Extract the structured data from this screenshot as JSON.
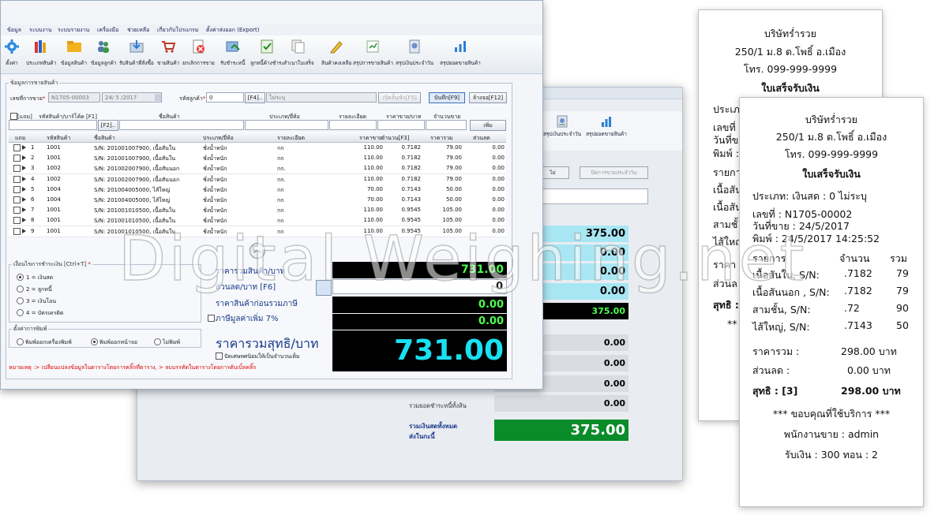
{
  "menu": [
    "ข้อมูล",
    "ระบบงาน",
    "ระบบรายงาน",
    "เครื่องมือ",
    "ช่วยเหลือ",
    "เกี่ยวกับโปรแกรม",
    "ตั้งค่าส่งออก (Export)"
  ],
  "toolbar": [
    "ตั้งค่า",
    "ประเภทสินค้า",
    "ข้อมูลสินค้า",
    "ข้อมูลลูกค้า",
    "รับสินค้าที่สั่งซื้อ",
    "ขายสินค้า",
    "ยกเลิกการขาย",
    "รับชำระหนี้",
    "ลูกหนี้ค้างชำระ",
    "สำเนาใบเสร็จ",
    "สินค้าคงเหลือ",
    "สรุปการขายสินค้า",
    "สรุปเงินประจำวัน",
    "สรุปยอดขายสินค้า"
  ],
  "sale": {
    "section_title": "ข้อมูลการขายสินค้า",
    "invoice_label": "เลขที่การขาย",
    "invoice_value": "N1705-00003",
    "date_value": "24/ 5 /2017",
    "customer_label": "รหัสลูกค้า",
    "customer_value": "0",
    "f4": "[F4]..",
    "unspecified": "ไม่ระบุ",
    "btn_cancel_bill": "เปิดลิ้นชัก[F5]",
    "btn_save": "บันทึก[F9]",
    "btn_clear": "ล้างจอ[F12]",
    "freebie": "[แถม]",
    "barcode_label": "รหัสสินค้า/บาร์โค้ด [F1]",
    "name_label": "ชื่อสินค้า",
    "type_label": "ประเภท/ยี่ห้อ",
    "detail_label": "รายละเอียด",
    "price_label": "ราคาขาย/บาท",
    "qty_label": "จำนวนขาย",
    "f2": "[F2]..",
    "add_btn": "เพิ่ม"
  },
  "grid": {
    "headers": [
      "แถม",
      "รหัสสินค้า",
      "ชื่อสินค้า",
      "ประเภท/ยี่ห้อ",
      "รายละเอียด",
      "ราคาขาย",
      "จำนวน[F3]",
      "ราคารวม",
      "ส่วนลด"
    ],
    "rows": [
      {
        "n": "1",
        "code": "1001",
        "name": "S/N: 201001007900,  เนื้อสันใน",
        "type": "ชั่งน้ำหนัก",
        "detail": "กก",
        "price": "110.00",
        "qty": "0.7182",
        "total": "79.00",
        "disc": "0.00"
      },
      {
        "n": "2",
        "code": "1001",
        "name": "S/N: 201001007900,  เนื้อสันใน",
        "type": "ชั่งน้ำหนัก",
        "detail": "กก",
        "price": "110.00",
        "qty": "0.7182",
        "total": "79.00",
        "disc": "0.00"
      },
      {
        "n": "3",
        "code": "1002",
        "name": "S/N: 201002007900,  เนื้อสันนอก",
        "type": "ชั่งน้ำหนัก",
        "detail": "กก.",
        "price": "110.00",
        "qty": "0.7182",
        "total": "79.00",
        "disc": "0.00"
      },
      {
        "n": "4",
        "code": "1002",
        "name": "S/N: 201002007900,  เนื้อสันนอก",
        "type": "ชั่งน้ำหนัก",
        "detail": "กก.",
        "price": "110.00",
        "qty": "0.7182",
        "total": "79.00",
        "disc": "0.00"
      },
      {
        "n": "5",
        "code": "1004",
        "name": "S/N: 201004005000,  ไส้ใหญ่",
        "type": "ชั่งน้ำหนัก",
        "detail": "กก",
        "price": "70.00",
        "qty": "0.7143",
        "total": "50.00",
        "disc": "0.00"
      },
      {
        "n": "6",
        "code": "1004",
        "name": "S/N: 201004005000,  ไส้ใหญ่",
        "type": "ชั่งน้ำหนัก",
        "detail": "กก",
        "price": "70.00",
        "qty": "0.7143",
        "total": "50.00",
        "disc": "0.00"
      },
      {
        "n": "7",
        "code": "1001",
        "name": "S/N: 201001010500,  เนื้อสันใน",
        "type": "ชั่งน้ำหนัก",
        "detail": "กก",
        "price": "110.00",
        "qty": "0.9545",
        "total": "105.00",
        "disc": "0.00"
      },
      {
        "n": "8",
        "code": "1001",
        "name": "S/N: 201001010500,  เนื้อสันใน",
        "type": "ชั่งน้ำหนัก",
        "detail": "กก",
        "price": "110.00",
        "qty": "0.9545",
        "total": "105.00",
        "disc": "0.00"
      },
      {
        "n": "9",
        "code": "1001",
        "name": "S/N: 201001010500,  เนื้อสันใน",
        "type": "ชั่งน้ำหนัก",
        "detail": "กก",
        "price": "110.00",
        "qty": "0.9545",
        "total": "105.00",
        "disc": "0.00"
      }
    ]
  },
  "payment": {
    "title": "เงื่อนไขการชำระเงิน [Ctrl+T]",
    "options": [
      "1 = เงินสด",
      "2 = ลูกหนี้",
      "3 = เงินโอน",
      "4 = บัตรเครดิต"
    ],
    "print_title": "ตั้งค่าการพิมพ์",
    "print_options": [
      "พิมพ์ออกเครื่องพิมพ์",
      "พิมพ์ออกหน้าจอ",
      "ไม่พิมพ์"
    ]
  },
  "summary": {
    "total_label": "ราคารวมสินค้า/บาท",
    "total_value": "731.00",
    "discount_label": "ส่วนลด/บาท [F6]",
    "discount_value": "0",
    "before_vat_label": "ราคาสินค้าก่อนรวมภาษี",
    "before_vat_value": "0.00",
    "vat_label": "ภาษีมูลค่าเพิ่ม 7%",
    "vat_value": "0.00",
    "net_label": "ราคารวมสุทธิ/บาท",
    "net_value": "731.00",
    "round_label": "ปัดเศษทศนิยมให้เป็นจำนวนเต็ม"
  },
  "note": "หมายเหตุ :> เปลี่ยนแปลงข้อมูลในตารางโดยการคลิ๊กที่ตาราง,  > ลบบรรทัดในตารางโดยการดับเบิ้ลคลิ๊ก",
  "back_window": {
    "btn_right": "ปิดการขายประจำวัน",
    "btn_left": "ไม่",
    "tb_items": [
      "สรุปเงินประจำวัน",
      "สรุปยอดขายสินค้า"
    ],
    "values": [
      "375.00",
      "0.00",
      "0.00",
      "0.00",
      "375.00",
      "0.00",
      "0.00",
      "0.00",
      "0.00"
    ],
    "debt_label": "รวมยอดชำระหนี้ทั้งสิน",
    "cash_label_1": "รวมเงินสดทั้งหมด",
    "cash_label_2": "ส่งในกะนี้",
    "cash_value": "375.00"
  },
  "receipt_back": {
    "company": "บริษัทร่ำรวย",
    "address": "250/1 ม.8 ต.โพธิ์ อ.เมือง",
    "phone": "โทร. 099-999-9999",
    "title": "ใบเสร็จรับเงิน",
    "partial": [
      "ประเภ",
      "เลขที่",
      "วันที่ข",
      "พิมพ์ :",
      "รายกา",
      "เนื้อสัน",
      "เนื้อสัน",
      "สามชั้",
      "ไส้ใหญ่",
      "ราคา",
      "ส่วนล",
      "สุทธิ :",
      "**"
    ]
  },
  "receipt_front": {
    "company": "บริษัทร่ำรวย",
    "address": "250/1 ม.8 ต.โพธิ์ อ.เมือง",
    "phone": "โทร. 099-999-9999",
    "title": "ใบเสร็จรับเงิน",
    "type_line": "ประเภท:  เงินสด : 0  ไม่ระบุ",
    "number_line": "เลขที่ : N1705-00002",
    "date_line": "วันที่ขาย : 24/5/2017",
    "print_line": "พิมพ์ : 24/5/2017      14:25:52",
    "items_header": [
      "รายการ",
      "จำนวน",
      "รวม"
    ],
    "items": [
      {
        "name": "เนื้อสันใน, S/N:",
        "qty": ".7182",
        "total": "79"
      },
      {
        "name": "เนื้อสันนอก  , S/N:",
        "qty": ".7182",
        "total": "79"
      },
      {
        "name": "สามชั้น, S/N:",
        "qty": ".72",
        "total": "90"
      },
      {
        "name": "ไส้ใหญ่, S/N:",
        "qty": ".7143",
        "total": "50"
      }
    ],
    "total_label": "ราคารวม :",
    "total_value": "298.00 บาท",
    "discount_label": "ส่วนลด :",
    "discount_value": "0.00 บาท",
    "net_label": "สุทธิ :  [3]",
    "net_value": "298.00 บาท",
    "thanks": "*** ขอบคุณที่ใช้บริการ ***",
    "cashier": "พนักงานขาย : admin",
    "change": "รับเงิน : 300  ทอน : 2"
  },
  "watermark": "Digital Weighing.net",
  "colors": {
    "accent": "#1a3a8a",
    "green_box": "#0a8c2a",
    "cyan_box": "#a8e6f3",
    "sum_text_green": "#4cff4c",
    "sum_text_cyan": "#18e1f2"
  }
}
